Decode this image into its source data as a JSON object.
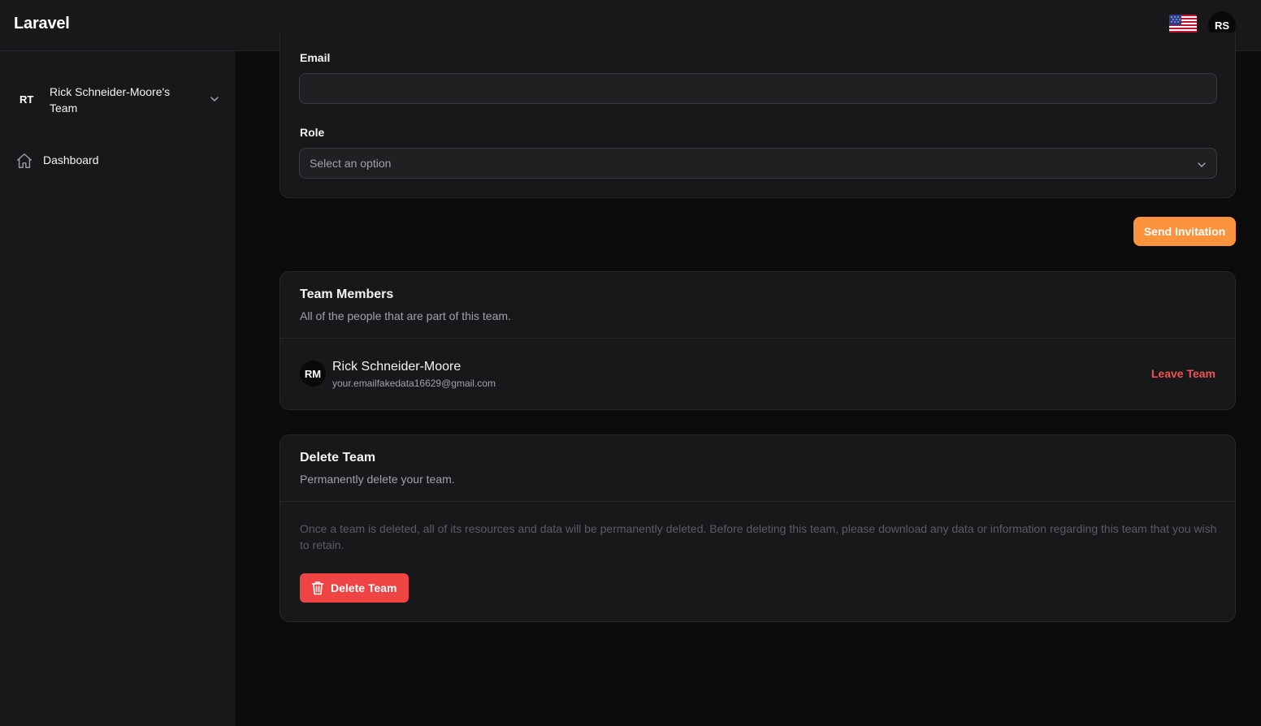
{
  "app": {
    "brand": "Laravel",
    "user_initials": "RS",
    "locale_icon": "us-flag-icon"
  },
  "sidebar": {
    "team": {
      "initials": "RT",
      "name": "Rick Schneider-Moore's Team"
    },
    "items": [
      {
        "label": "Dashboard",
        "icon": "home-icon"
      }
    ]
  },
  "invite": {
    "email_label": "Email",
    "email_value": "",
    "role_label": "Role",
    "role_placeholder": "Select an option",
    "send_label": "Send Invitation"
  },
  "members": {
    "title": "Team Members",
    "subtitle": "All of the people that are part of this team.",
    "list": [
      {
        "initials": "RM",
        "name": "Rick Schneider-Moore",
        "email": "your.emailfakedata16629@gmail.com",
        "action": "Leave Team"
      }
    ]
  },
  "delete_team": {
    "title": "Delete Team",
    "subtitle": "Permanently delete your team.",
    "description": "Once a team is deleted, all of its resources and data will be permanently deleted. Before deleting this team, please download any data or information regarding this team that you wish to retain.",
    "button_label": "Delete Team"
  },
  "colors": {
    "accent": "#fb923c",
    "danger": "#ef4444",
    "danger_text": "#f05252",
    "background": "#0c0c0d",
    "surface": "#18181b"
  }
}
